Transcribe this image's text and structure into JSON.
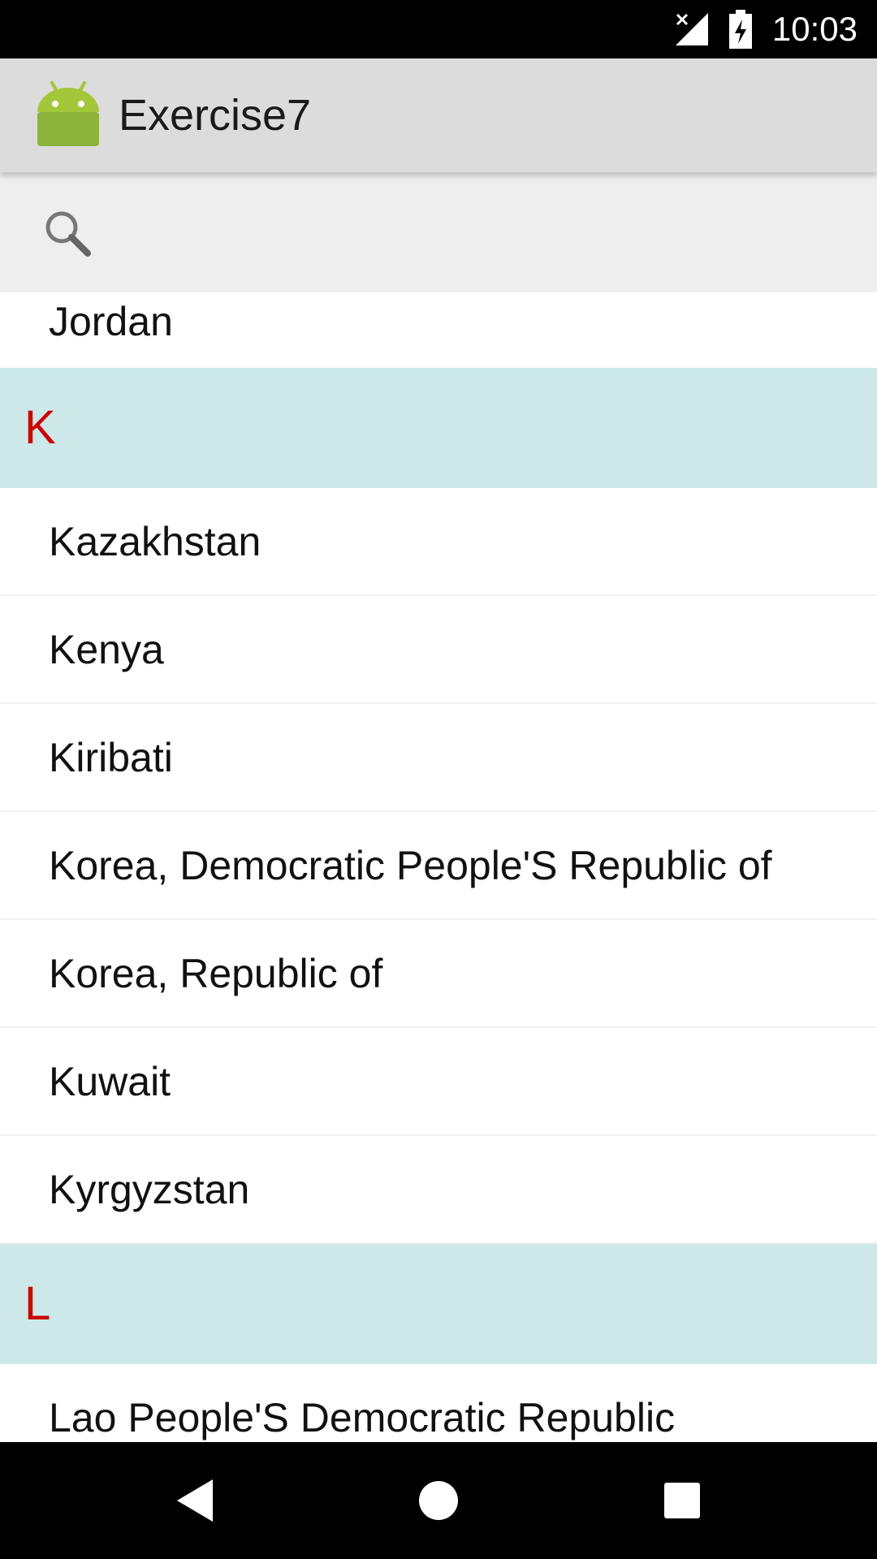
{
  "status_bar": {
    "time": "10:03",
    "icons": [
      "signal-off-icon",
      "battery-charging-icon"
    ]
  },
  "app_bar": {
    "icon": "android-robot-icon",
    "title": "Exercise7"
  },
  "search": {
    "icon": "search-icon",
    "value": "",
    "placeholder": ""
  },
  "list": {
    "partial_top": "Jordan",
    "sections": [
      {
        "letter": "K",
        "items": [
          "Kazakhstan",
          "Kenya",
          "Kiribati",
          "Korea, Democratic People'S Republic of",
          "Korea, Republic of",
          "Kuwait",
          "Kyrgyzstan"
        ]
      },
      {
        "letter": "L",
        "items": [
          "Lao People'S Democratic Republic"
        ]
      }
    ]
  },
  "nav_bar": {
    "buttons": [
      "back-icon",
      "home-icon",
      "recents-icon"
    ]
  },
  "colors": {
    "section_header_bg": "#cce8e8",
    "section_letter": "#cc0000",
    "app_bar_bg": "#dcdcdc",
    "search_bar_bg": "#eeeeee",
    "android_green": "#a4c639"
  }
}
